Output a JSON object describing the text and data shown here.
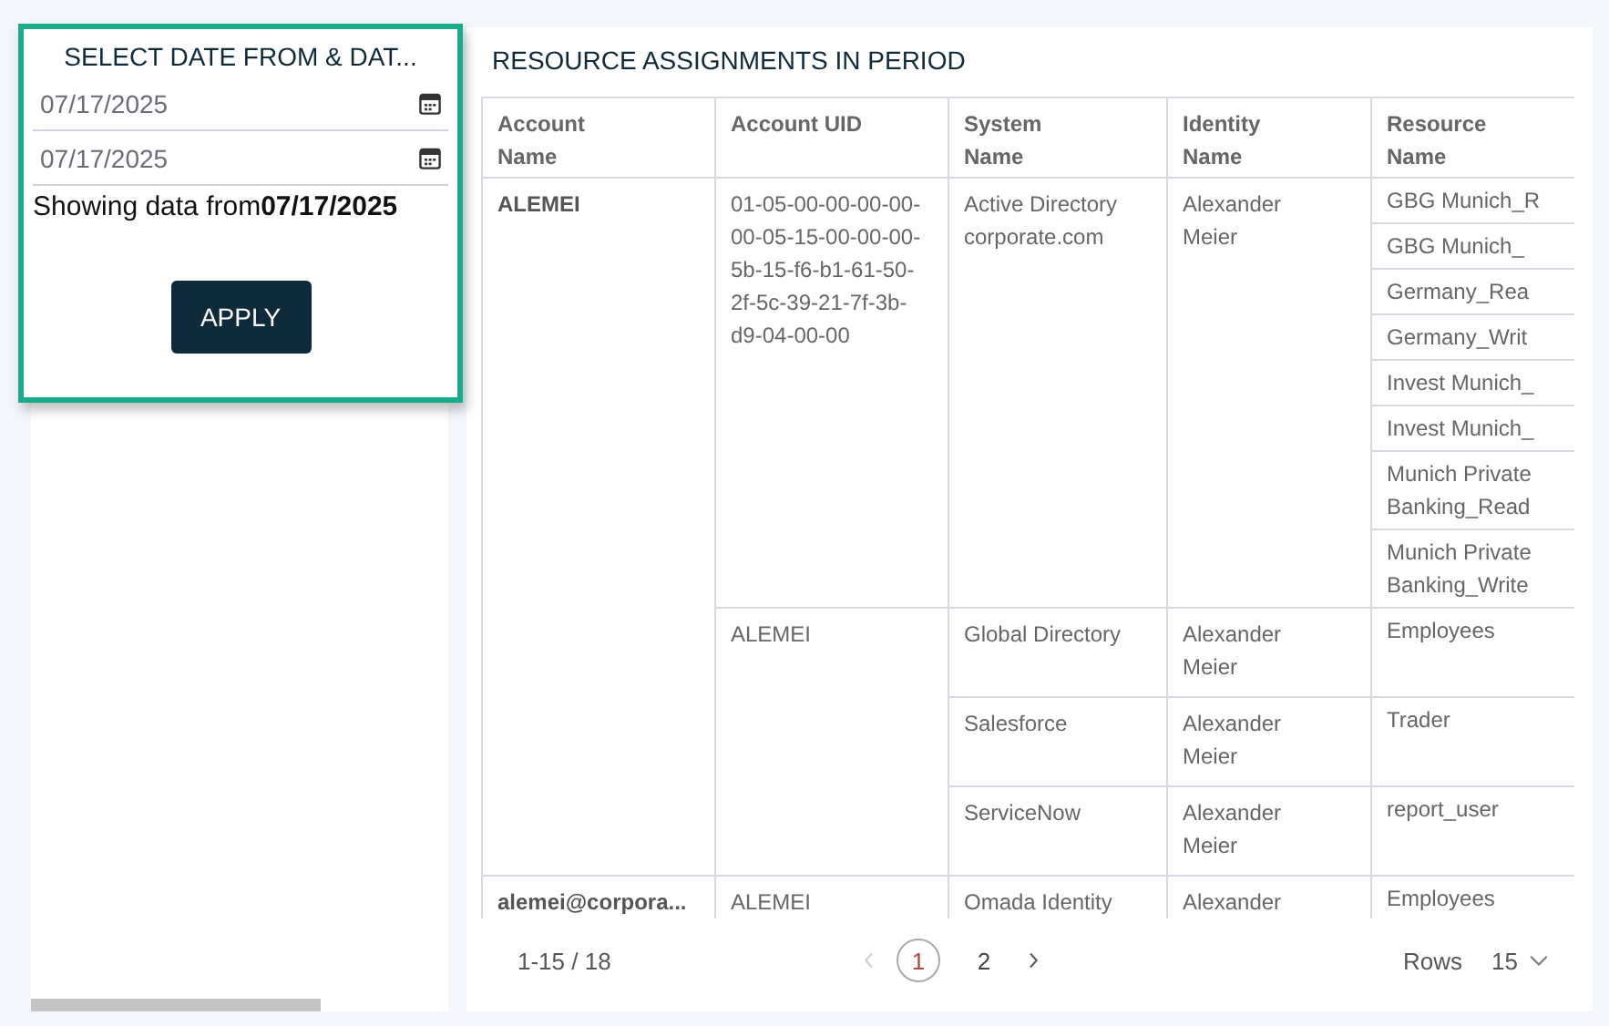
{
  "date_panel": {
    "title": "SELECT DATE FROM & DAT...",
    "date_from": "07/17/2025",
    "date_to": "07/17/2025",
    "summary": "Showing data from**07/17/2025**",
    "apply_button": "APPLY"
  },
  "assignments": {
    "title": "RESOURCE ASSIGNMENTS IN PERIOD",
    "columns": [
      "Account\nName",
      "Account UID",
      "System\nName",
      "Identity\nName",
      "Resource\nName"
    ],
    "accounts": [
      {
        "name": "ALEMEI",
        "uids": [
          {
            "uid": "01-05-00-00-00-00-00-05-15-00-00-00-5b-15-f6-b1-61-50-2f-5c-39-21-7f-3b-d9-04-00-00",
            "systems": [
              {
                "system": "Active Directory corporate.com",
                "identity": "Alexander Meier",
                "resources": [
                  "GBG Munich_R",
                  "GBG Munich_",
                  "Germany_Rea",
                  "Germany_Writ",
                  "Invest Munich_",
                  "Invest Munich_",
                  "Munich Private Banking_Read",
                  "Munich Private Banking_Write"
                ]
              }
            ]
          },
          {
            "uid": "ALEMEI",
            "systems": [
              {
                "system": "Global Directory",
                "identity": "Alexander Meier",
                "resources": [
                  "Employees"
                ]
              },
              {
                "system": "Salesforce",
                "identity": "Alexander Meier",
                "resources": [
                  "Trader"
                ]
              },
              {
                "system": "ServiceNow",
                "identity": "Alexander Meier",
                "resources": [
                  "report_user"
                ]
              }
            ]
          }
        ]
      },
      {
        "name": "alemei@corpora...",
        "uids": [
          {
            "uid": "ALEMEI",
            "systems": [
              {
                "system": "Omada Identity",
                "identity": "Alexander",
                "resources": [
                  "Employees"
                ]
              }
            ]
          }
        ]
      }
    ],
    "pagination": {
      "range": "1-15 / 18",
      "prev_disabled": true,
      "next_disabled": false,
      "pages": [
        {
          "label": "1",
          "selected": true
        },
        {
          "label": "2",
          "selected": false
        }
      ],
      "rows_label": "Rows",
      "rows_value": "15"
    }
  }
}
